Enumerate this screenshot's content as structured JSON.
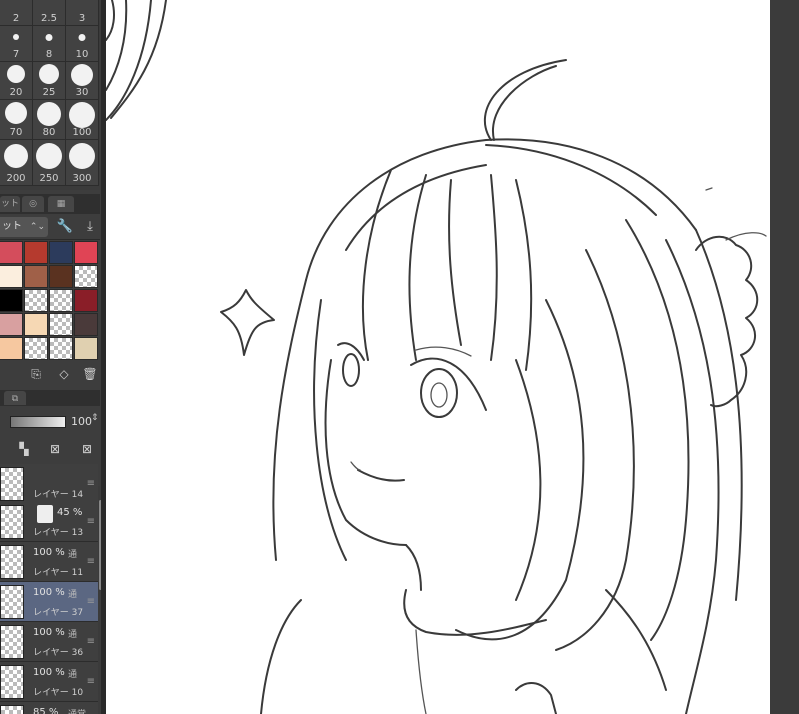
{
  "brush_sizes": [
    {
      "label": "2"
    },
    {
      "label": "2.5"
    },
    {
      "label": "3"
    },
    {
      "label": "7"
    },
    {
      "label": "8"
    },
    {
      "label": "10"
    },
    {
      "label": "20"
    },
    {
      "label": "25"
    },
    {
      "label": "30"
    },
    {
      "label": "70"
    },
    {
      "label": "80"
    },
    {
      "label": "100"
    },
    {
      "label": "200"
    },
    {
      "label": "250"
    },
    {
      "label": "300"
    }
  ],
  "colorset": {
    "tab1": "ット",
    "select_label": "ット",
    "swatches": [
      "#d44d5c",
      "#b53a2e",
      "#2c3b5c",
      "#e04455",
      "#fbeede",
      "#a06048",
      "#5a3220",
      "checker",
      "#000000",
      "checker",
      "checker",
      "#8a1e28",
      "#d8a0a0",
      "#f6d8b4",
      "checker",
      "#4a3a3a",
      "#f6c8a0",
      "checker",
      "checker",
      "#e0d0b0"
    ]
  },
  "layer_panel": {
    "opacity": "100"
  },
  "layers": [
    {
      "opacity": "",
      "mode": "",
      "name": "レイヤー 14",
      "selected": false
    },
    {
      "opacity": "45 %",
      "mode": "",
      "name": "レイヤー 13",
      "selected": false
    },
    {
      "opacity": "100 %",
      "mode": "通",
      "name": "レイヤー 11",
      "selected": false
    },
    {
      "opacity": "100 %",
      "mode": "通",
      "name": "レイヤー 37",
      "selected": true
    },
    {
      "opacity": "100 %",
      "mode": "通",
      "name": "レイヤー 36",
      "selected": false
    },
    {
      "opacity": "100 %",
      "mode": "通",
      "name": "レイヤー 10",
      "selected": false
    },
    {
      "opacity": "85 %",
      "mode": "通常",
      "name": "",
      "selected": false
    }
  ]
}
